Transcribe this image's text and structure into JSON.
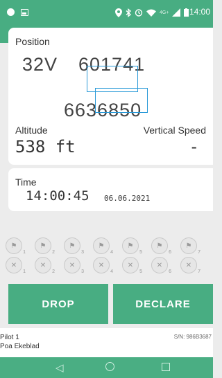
{
  "status_bar": {
    "time": "14:00",
    "network": "4G+"
  },
  "gps": {
    "status_label": "good"
  },
  "position": {
    "label": "Position",
    "zone": "32V",
    "easting": "601741",
    "northing": "6636850"
  },
  "altitude": {
    "label": "Altitude",
    "value": "538 ft"
  },
  "vertical_speed": {
    "label": "Vertical Speed",
    "value": "-"
  },
  "time_card": {
    "label": "Time",
    "time": "14:00:45",
    "date": "06.06.2021"
  },
  "slots": {
    "top": [
      "1",
      "2",
      "3",
      "4",
      "5",
      "6",
      "7"
    ],
    "bottom": [
      "1",
      "2",
      "3",
      "4",
      "5",
      "6",
      "7"
    ]
  },
  "buttons": {
    "drop": "DROP",
    "declare": "DECLARE"
  },
  "pilot": {
    "title": "Pilot 1",
    "name": "Poa Ekeblad",
    "serial": "S/N: 986B3687"
  },
  "colors": {
    "accent": "#48ad82",
    "highlight": "#2a9ad8"
  }
}
